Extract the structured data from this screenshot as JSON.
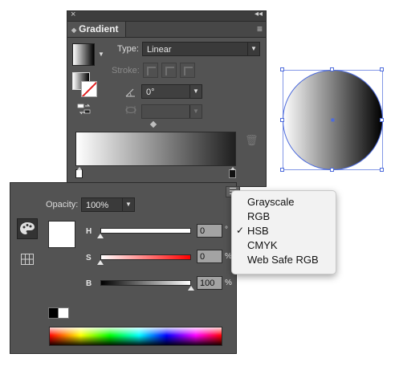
{
  "gradient_panel": {
    "title": "Gradient",
    "close_glyph": "×",
    "collapse_glyph": "◂◂",
    "menu_glyph": "≡",
    "type_label": "Type:",
    "type_value": "Linear",
    "stroke_label": "Stroke:",
    "angle_value": "0°",
    "aspect_value": "",
    "gradient_stops": [
      {
        "color": "#ffffff",
        "location_pct": 0
      },
      {
        "color": "#000000",
        "location_pct": 100
      }
    ]
  },
  "color_panel": {
    "opacity_label": "Opacity:",
    "opacity_value": "100%",
    "sliders": [
      {
        "label": "H",
        "value": "0",
        "unit": "°",
        "level_pct": 0
      },
      {
        "label": "S",
        "value": "0",
        "unit": "%",
        "level_pct": 0
      },
      {
        "label": "B",
        "value": "100",
        "unit": "%",
        "level_pct": 100
      }
    ],
    "current_color": "#ffffff"
  },
  "color_mode_menu": {
    "items": [
      {
        "label": "Grayscale",
        "checked": false
      },
      {
        "label": "RGB",
        "checked": false
      },
      {
        "label": "HSB",
        "checked": true
      },
      {
        "label": "CMYK",
        "checked": false
      },
      {
        "label": "Web Safe RGB",
        "checked": false
      }
    ],
    "check_glyph": "✓"
  },
  "canvas": {
    "selection_color": "#4d6bdc",
    "object_fill": "linear-gradient white to black"
  }
}
